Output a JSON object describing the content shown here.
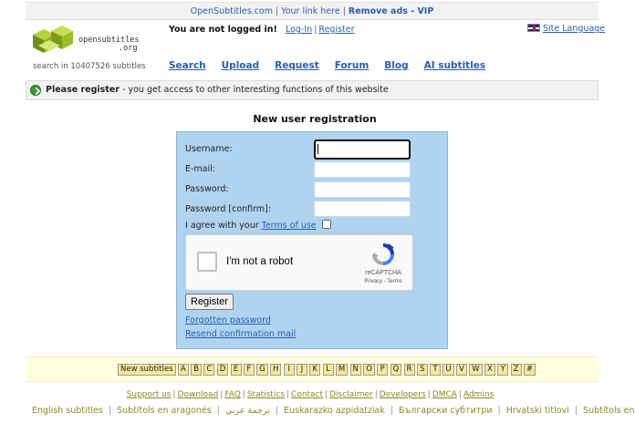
{
  "topbar": {
    "site": "OpenSubtitles.com",
    "your_link": "Your link here",
    "remove_ads": "Remove ads - VIP"
  },
  "logo": {
    "line1": "opensubtitles",
    "line2": ".org"
  },
  "stats": "search in 10407526 subtitles",
  "account": {
    "not_logged": "You are not logged in!",
    "login": "Log-In",
    "register": "Register"
  },
  "site_language": "Site Language",
  "nav": [
    "Search",
    "Upload",
    "Request",
    "Forum",
    "Blog",
    "AI subtitles"
  ],
  "notice": {
    "bold": "Please register",
    "rest": " - you get access to other interesting functions of this website"
  },
  "form": {
    "title": "New user registration",
    "username_label": "Username:",
    "email_label": "E-mail:",
    "password_label": "Password:",
    "password_confirm_label": "Password [confirm]:",
    "agree_text": "I agree with your ",
    "terms_link": "Terms of use",
    "captcha_text": "I'm not a robot",
    "captcha_brand": "reCAPTCHA",
    "captcha_terms": "Privacy - Terms",
    "register_button": "Register",
    "forgotten": "Forgotten password",
    "resend": "Resend confirmation mail"
  },
  "alphabet": [
    "New subtitles",
    "A",
    "B",
    "C",
    "D",
    "E",
    "F",
    "G",
    "H",
    "I",
    "J",
    "K",
    "L",
    "M",
    "N",
    "O",
    "P",
    "Q",
    "R",
    "S",
    "T",
    "U",
    "V",
    "W",
    "X",
    "Y",
    "Z",
    "#"
  ],
  "footer_links": [
    "Support us",
    "Download",
    "FAQ",
    "Statistics",
    "Contact",
    "Disclaimer",
    "Developers",
    "DMCA",
    "Admins"
  ],
  "languages": [
    "English subtitles",
    "Subtítols en aragonés",
    "ترجمة عربي",
    "Euskarazko azpidatziak",
    "Български субтитри",
    "Hrvatski titlovi",
    "Subtítols en Català"
  ],
  "colors": {
    "link": "#2a5db0",
    "form_bg": "#b0d4f0",
    "alpha_bg": "#ffffdd",
    "letter_bg": "#f6e89a",
    "footer_link": "#8a8a20"
  }
}
